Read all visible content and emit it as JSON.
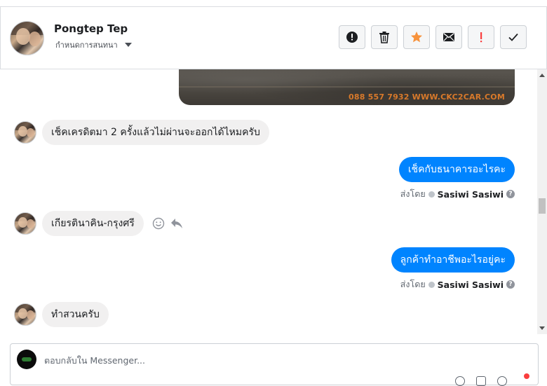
{
  "header": {
    "contact_name": "Pongtep Tep",
    "assign_label": "กำหนดการสนทนา",
    "actions": [
      {
        "name": "mark-spam-button",
        "icon": "alert-circle-icon"
      },
      {
        "name": "delete-button",
        "icon": "trash-icon"
      },
      {
        "name": "star-button",
        "icon": "star-icon",
        "color": "#f7923b"
      },
      {
        "name": "mark-unread-button",
        "icon": "envelope-icon"
      },
      {
        "name": "follow-up-button",
        "icon": "exclamation-icon",
        "color": "#fa3e3e"
      },
      {
        "name": "mark-done-button",
        "icon": "checkmark-icon"
      }
    ]
  },
  "thread": {
    "photo_watermark": "088 557 7932 WWW.CKC2CAR.COM",
    "messages": [
      {
        "direction": "in",
        "text": "เช็คเครดิตมา 2 ครั้งแล้วไม่ผ่านจะออกได้ไหมครับ"
      },
      {
        "direction": "out",
        "text": "เช็คกับธนาคารอะไรคะ",
        "sent_by_label": "ส่งโดย",
        "sender": "Sasiwi Sasiwi"
      },
      {
        "direction": "in",
        "text": "เกียรตินาคิน-กรุงศรี"
      },
      {
        "direction": "out",
        "text": "ลูกค้าทำอาชีพอะไรอยู่คะ",
        "sent_by_label": "ส่งโดย",
        "sender": "Sasiwi Sasiwi"
      },
      {
        "direction": "in",
        "text": "ทำสวนครับ"
      }
    ]
  },
  "composer": {
    "placeholder": "ตอบกลับใน Messenger..."
  },
  "colors": {
    "outgoing_bubble": "#0084ff",
    "incoming_bubble": "#f1f0f0",
    "star": "#f7923b",
    "alert": "#fa3e3e"
  }
}
